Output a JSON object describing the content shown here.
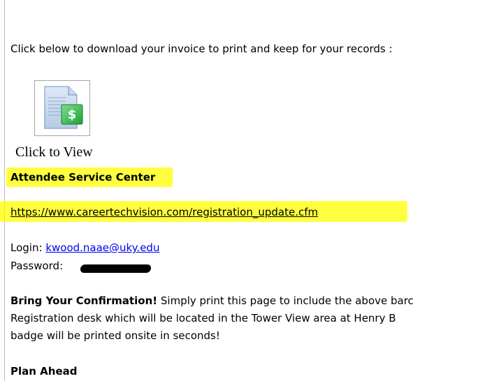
{
  "email": {
    "download_instruction": "Click below to download your invoice to print and keep for your records :",
    "invoice_icon": "invoice-dollar-icon",
    "click_to_view": "Click to View",
    "attendee_service_center": "Attendee Service Center",
    "registration_url": "https://www.careertechvision.com/registration_update.cfm",
    "login_label": "Login:",
    "login_email": "kwood.naae@uky.edu",
    "password_label": "Password:",
    "confirmation_heading": "Bring Your Confirmation!",
    "confirmation_line1_rest": "Simply print this page to include the above barc",
    "confirmation_line2": "Registration desk which will be located in the Tower View area at Henry B",
    "confirmation_line3": "badge will be printed onsite in seconds!",
    "plan_ahead": "Plan Ahead"
  },
  "colors": {
    "highlight": "#ffff00",
    "link": "#0000ee",
    "icon_green": "#2ecc40"
  }
}
